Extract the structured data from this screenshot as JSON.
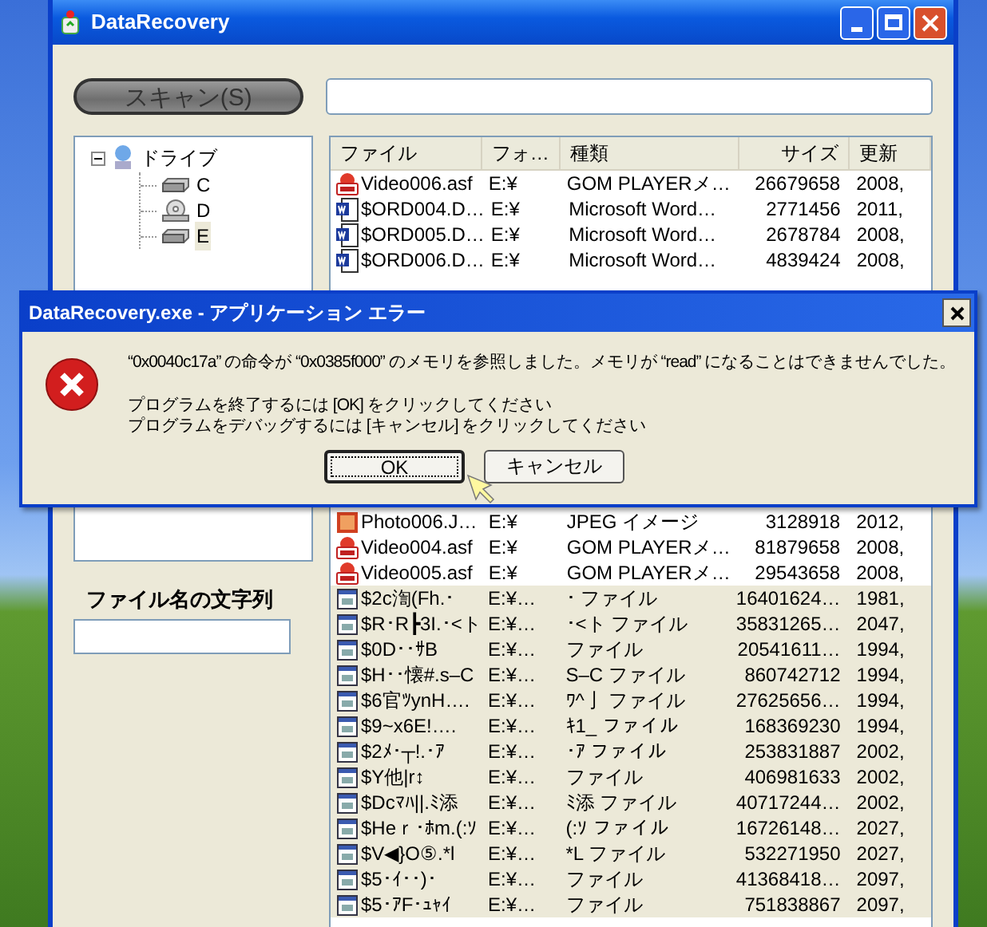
{
  "window": {
    "title": "DataRecovery"
  },
  "scan_button": {
    "label": "スキャン(S)"
  },
  "tree": {
    "label": "ドライブ",
    "expanded": true,
    "children": [
      {
        "label": "C",
        "kind": "disk",
        "selected": false
      },
      {
        "label": "D",
        "kind": "cdrom",
        "selected": false
      },
      {
        "label": "E",
        "kind": "disk",
        "selected": true
      }
    ]
  },
  "filename_filter": {
    "label": "ファイル名の文字列"
  },
  "table": {
    "columns": [
      "ファイル",
      "フォ…",
      "種類",
      "サイズ",
      "更新"
    ],
    "rows_above": [
      {
        "kind": "video",
        "cells": [
          "Video006.asf",
          "E:¥",
          "GOM PLAYERメ…",
          "26679658",
          "2008,"
        ]
      },
      {
        "kind": "word",
        "cells": [
          "$ORD004.D…",
          "E:¥",
          "Microsoft Word…",
          "2771456",
          "2011,"
        ]
      },
      {
        "kind": "word",
        "cells": [
          "$ORD005.D…",
          "E:¥",
          "Microsoft Word…",
          "2678784",
          "2008,"
        ]
      },
      {
        "kind": "word",
        "cells": [
          "$ORD006.D…",
          "E:¥",
          "Microsoft Word…",
          "4839424",
          "2008,"
        ]
      }
    ],
    "rows_below": [
      {
        "kind": "image",
        "cells": [
          "Photo006.J…",
          "E:¥",
          "JPEG イメージ",
          "3128918",
          "2012,"
        ]
      },
      {
        "kind": "video",
        "cells": [
          "Video004.asf",
          "E:¥",
          "GOM PLAYERメ…",
          "81879658",
          "2008,"
        ]
      },
      {
        "kind": "video",
        "cells": [
          "Video005.asf",
          "E:¥",
          "GOM PLAYERメ…",
          "29543658",
          "2008,"
        ]
      },
      {
        "kind": "unknown",
        "cells": [
          "$2c渹(Fh.･",
          "E:¥…",
          "･ ファイル",
          "16401624…",
          "1981,"
        ]
      },
      {
        "kind": "unknown",
        "cells": [
          "$R･R┣3I.･<ト",
          "E:¥…",
          "･<ト ファイル",
          "35831265…",
          "2047,"
        ]
      },
      {
        "kind": "unknown",
        "cells": [
          "$0D･･ｻB",
          "E:¥…",
          "ファイル",
          "20541611…",
          "1994,"
        ]
      },
      {
        "kind": "unknown",
        "cells": [
          "$H･･懐#.s–C",
          "E:¥…",
          "S–C ファイル",
          "860742712",
          "1994,"
        ]
      },
      {
        "kind": "unknown",
        "cells": [
          "$6官ﾂynH….",
          "E:¥…",
          "ﾜ^亅 ファイル",
          "27625656…",
          "1994,"
        ]
      },
      {
        "kind": "unknown",
        "cells": [
          "$9~x6E!….",
          "E:¥…",
          "ｷ1_ ファイル",
          "168369230",
          "1994,"
        ]
      },
      {
        "kind": "unknown",
        "cells": [
          "$2ﾒ･┬!.･ｱ",
          "E:¥…",
          "･ｱ ファイル",
          "253831887",
          "2002,"
        ]
      },
      {
        "kind": "unknown",
        "cells": [
          "$Y他|r↕",
          "E:¥…",
          "ファイル",
          "406981633",
          "2002,"
        ]
      },
      {
        "kind": "unknown",
        "cells": [
          "$Dcﾏﾊ||.ﾐ添",
          "E:¥…",
          "ﾐ添 ファイル",
          "40717244…",
          "2002,"
        ]
      },
      {
        "kind": "unknown",
        "cells": [
          "$Heｒ･ﾎm.(:ｿ",
          "E:¥…",
          "(:ｿ ファイル",
          "16726148…",
          "2027,"
        ]
      },
      {
        "kind": "unknown",
        "cells": [
          "$V◀}O⑤.*l",
          "E:¥…",
          "*L ファイル",
          "532271950",
          "2027,"
        ]
      },
      {
        "kind": "unknown",
        "cells": [
          "$5･ｲ･･)･",
          "E:¥…",
          "ファイル",
          "41368418…",
          "2097,"
        ]
      },
      {
        "kind": "unknown",
        "cells": [
          "$5･ｱF･ｭｬｲ",
          "E:¥…",
          "ファイル",
          "751838867",
          "2097,"
        ]
      }
    ]
  },
  "error_dialog": {
    "title": "DataRecovery.exe - アプリケーション エラー",
    "message": "“0x0040c17a” の命令が “0x0385f000” のメモリを参照しました。メモリが “read” になることはできませんでした。",
    "instructions": [
      "プログラムを終了するには [OK] をクリックしてください",
      "プログラムをデバッグするには [キャンセル] をクリックしてください"
    ],
    "buttons": [
      {
        "label": "OK",
        "selected": true
      },
      {
        "label": "キャンセル",
        "selected": false
      }
    ]
  }
}
